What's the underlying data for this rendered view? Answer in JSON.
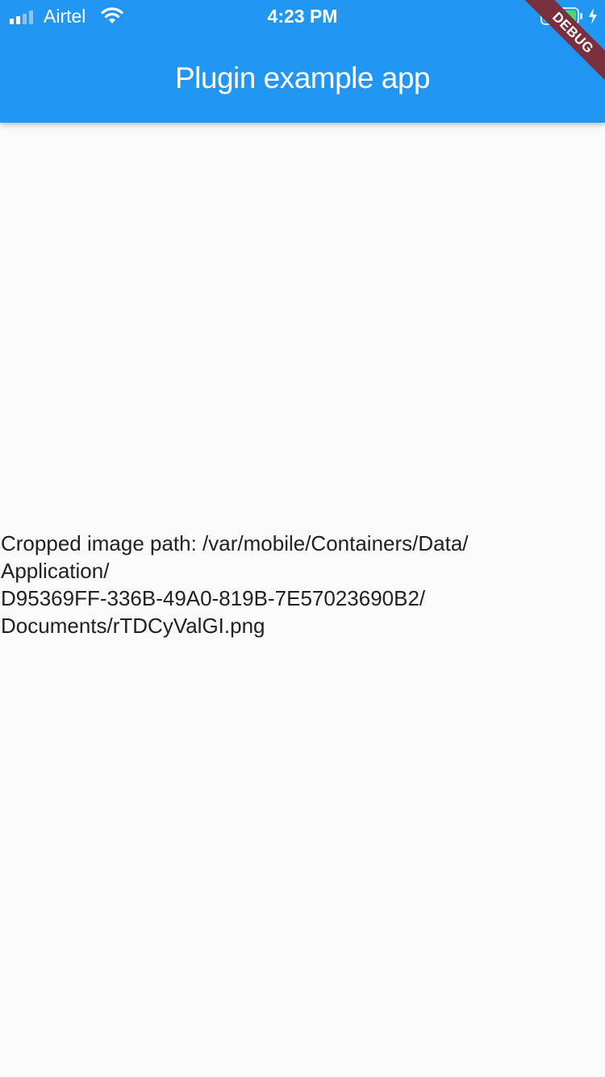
{
  "status_bar": {
    "carrier": "Airtel",
    "time": "4:23 PM",
    "icons": [
      "signal-icon",
      "wifi-icon",
      "battery-icon",
      "charging-icon"
    ],
    "battery_color": "#4cd964"
  },
  "app_bar": {
    "title": "Plugin example app",
    "color": "#2196f3"
  },
  "debug_banner": {
    "label": "DEBUG",
    "color": "#7a2f3f"
  },
  "body": {
    "cropped_path_text": "Cropped image path: /var/mobile/Containers/Data/\nApplication/\nD95369FF-336B-49A0-819B-7E57023690B2/\nDocuments/rTDCyValGI.png"
  }
}
